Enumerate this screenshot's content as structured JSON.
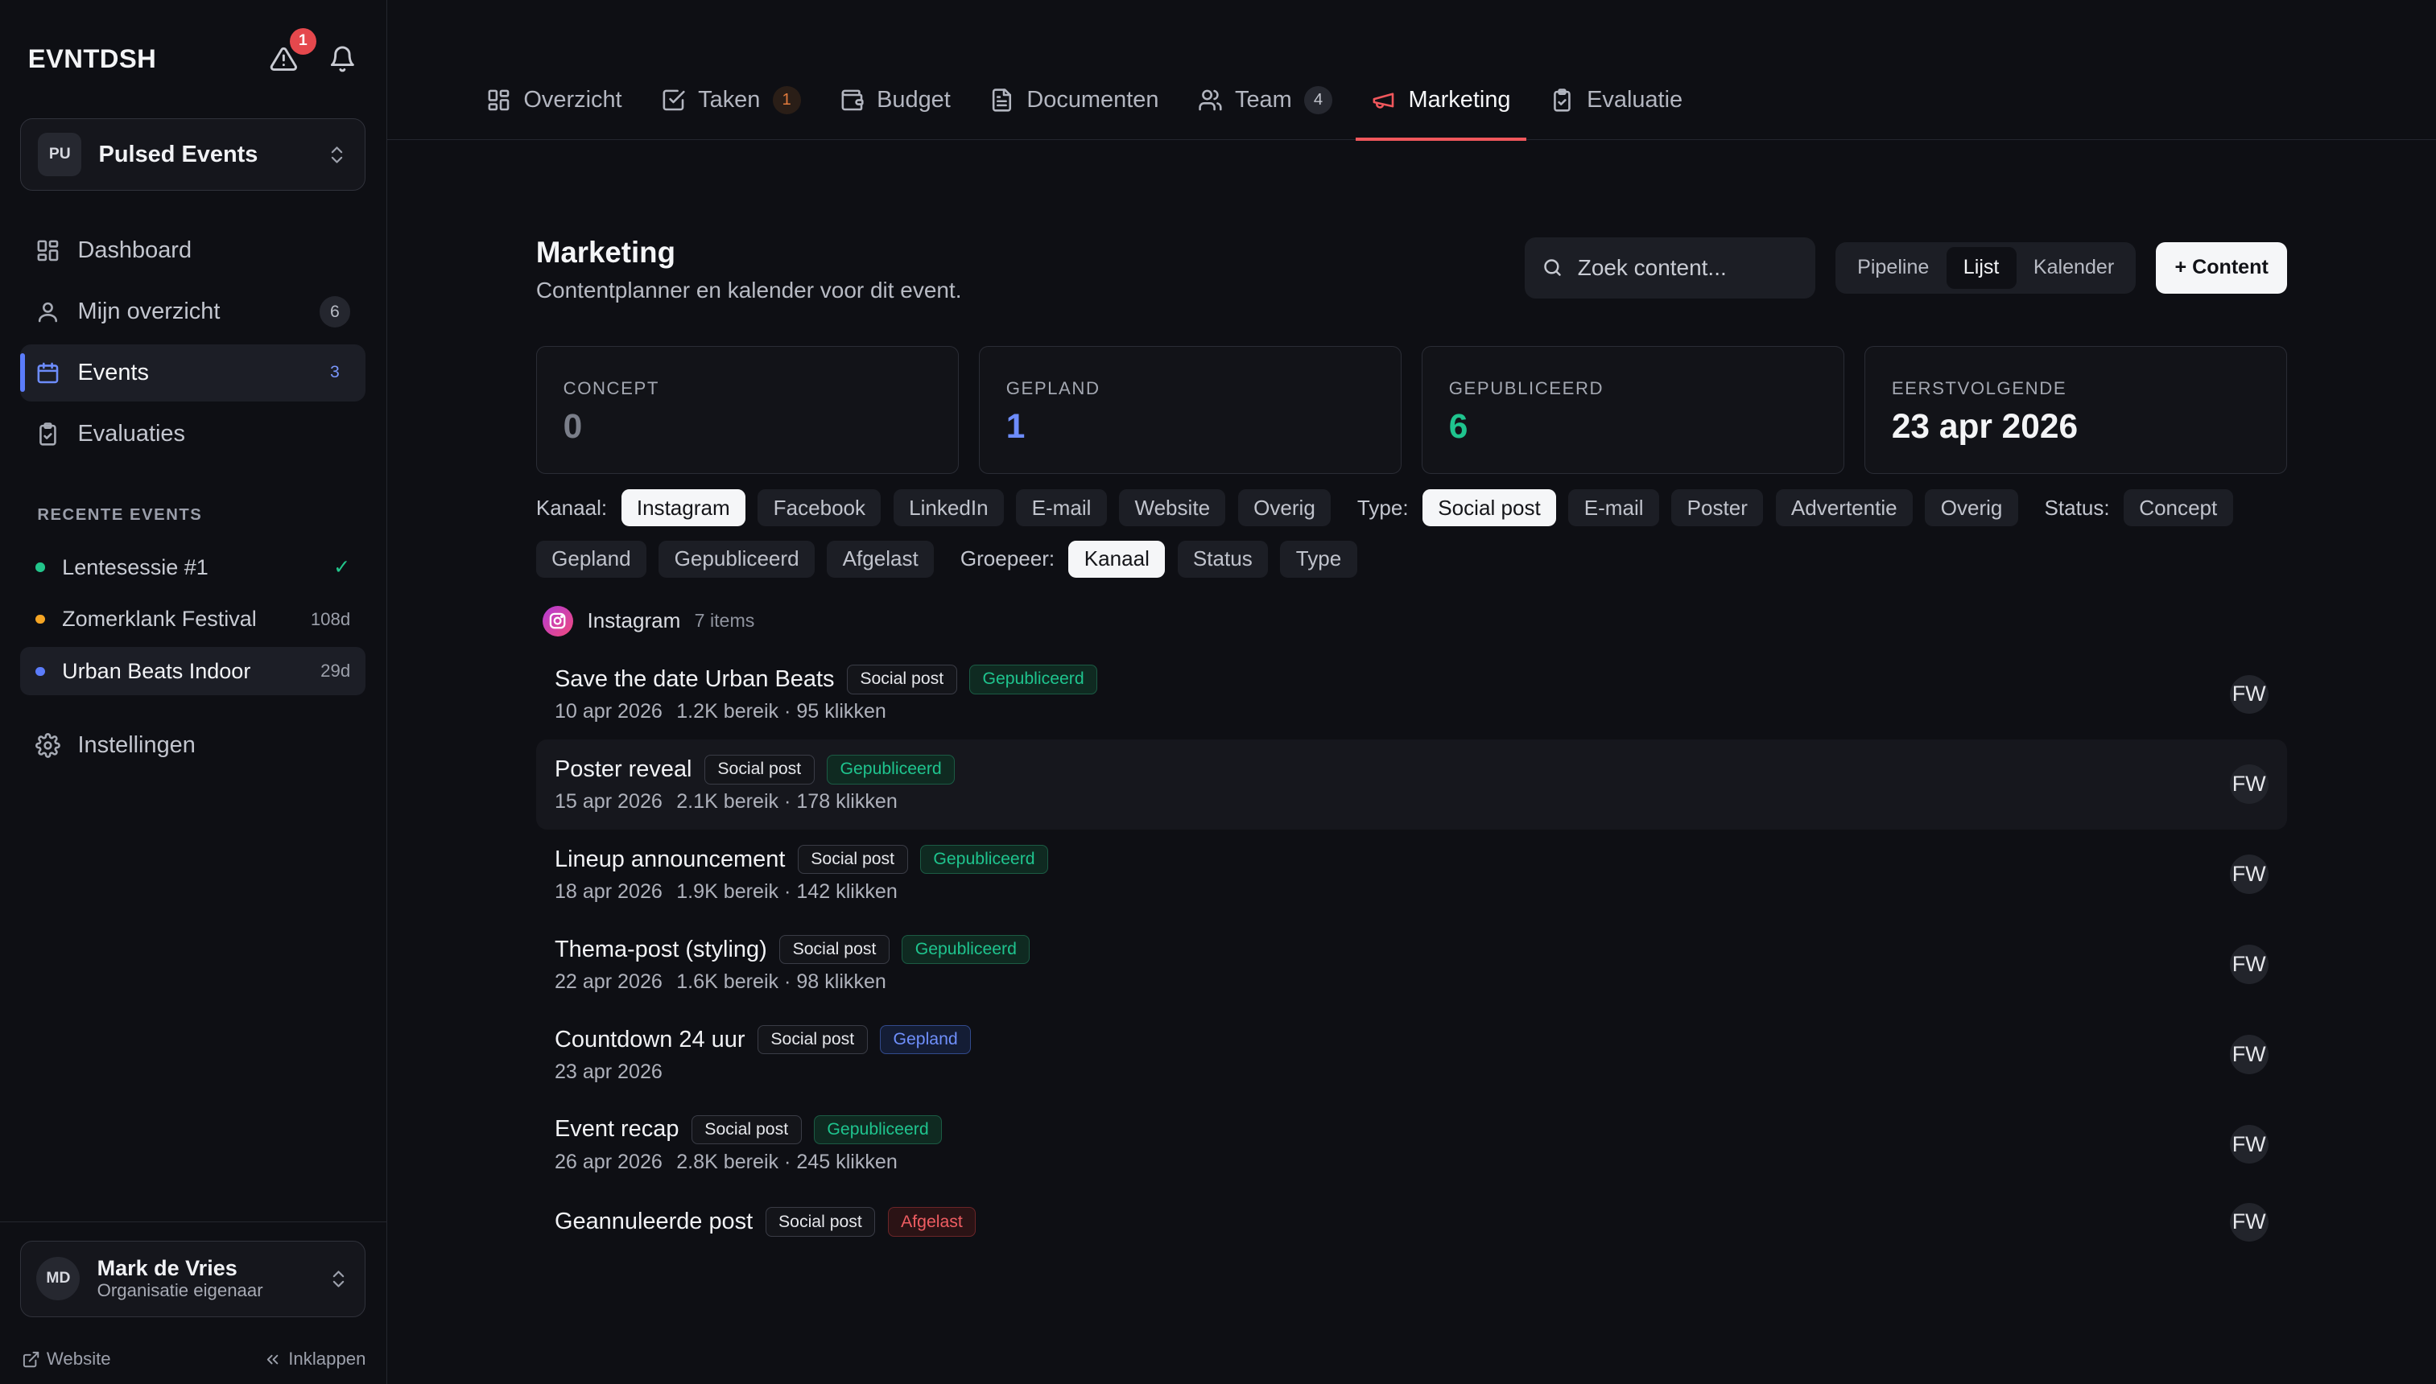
{
  "app": {
    "brand": "EVNTDSH",
    "alert_count": "1"
  },
  "org": {
    "initials": "PU",
    "name": "Pulsed Events"
  },
  "nav": [
    {
      "label": "Dashboard",
      "icon": "dashboard-icon",
      "count": ""
    },
    {
      "label": "Mijn overzicht",
      "icon": "user-icon",
      "count": "6"
    },
    {
      "label": "Events",
      "icon": "calendar-icon",
      "count": "3"
    },
    {
      "label": "Evaluaties",
      "icon": "clipboard-icon",
      "count": ""
    }
  ],
  "recent": {
    "label": "RECENTE EVENTS",
    "items": [
      {
        "name": "Lentesessie #1",
        "meta": "✓",
        "dot": "#22c58b"
      },
      {
        "name": "Zomerklank Festival",
        "meta": "108d",
        "dot": "#f5a524"
      },
      {
        "name": "Urban Beats Indoor",
        "meta": "29d",
        "dot": "#5b7cfa"
      }
    ]
  },
  "settings_label": "Instellingen",
  "user": {
    "initials": "MD",
    "name": "Mark de Vries",
    "role": "Organisatie eigenaar"
  },
  "footer": {
    "website": "Website",
    "collapse": "Inklappen"
  },
  "tabs": [
    {
      "label": "Overzicht",
      "icon": "grid-icon",
      "count": ""
    },
    {
      "label": "Taken",
      "icon": "checkbox-icon",
      "count": "1"
    },
    {
      "label": "Budget",
      "icon": "wallet-icon",
      "count": ""
    },
    {
      "label": "Documenten",
      "icon": "document-icon",
      "count": ""
    },
    {
      "label": "Team",
      "icon": "users-icon",
      "count": "4"
    },
    {
      "label": "Marketing",
      "icon": "megaphone-icon",
      "count": ""
    },
    {
      "label": "Evaluatie",
      "icon": "clipboard-icon",
      "count": ""
    }
  ],
  "page": {
    "title": "Marketing",
    "subtitle": "Contentplanner en kalender voor dit event.",
    "search_placeholder": "Zoek content...",
    "views": [
      "Pipeline",
      "Lijst",
      "Kalender"
    ],
    "active_view": "Lijst",
    "add_label": "+ Content"
  },
  "stats": [
    {
      "label": "CONCEPT",
      "value": "0"
    },
    {
      "label": "GEPLAND",
      "value": "1"
    },
    {
      "label": "GEPUBLICEERD",
      "value": "6"
    },
    {
      "label": "EERSTVOLGENDE",
      "value": "23 apr 2026"
    }
  ],
  "filters": {
    "kanaal_label": "Kanaal:",
    "kanaal": [
      "Instagram",
      "Facebook",
      "LinkedIn",
      "E-mail",
      "Website",
      "Overig"
    ],
    "type_label": "Type:",
    "type": [
      "Social post",
      "E-mail",
      "Poster",
      "Advertentie",
      "Overig"
    ],
    "status_label": "Status:",
    "status": [
      "Concept",
      "Gepland",
      "Gepubliceerd",
      "Afgelast"
    ],
    "group_label": "Groepeer:",
    "group": [
      "Kanaal",
      "Status",
      "Type"
    ]
  },
  "group": {
    "name": "Instagram",
    "count": "7 items"
  },
  "items": [
    {
      "title": "Save the date Urban Beats",
      "type": "Social post",
      "status": "Gepubliceerd",
      "date": "10 apr 2026",
      "stats": "1.2K bereik · 95 klikken",
      "owner": "FW"
    },
    {
      "title": "Poster reveal",
      "type": "Social post",
      "status": "Gepubliceerd",
      "date": "15 apr 2026",
      "stats": "2.1K bereik · 178 klikken",
      "owner": "FW"
    },
    {
      "title": "Lineup announcement",
      "type": "Social post",
      "status": "Gepubliceerd",
      "date": "18 apr 2026",
      "stats": "1.9K bereik · 142 klikken",
      "owner": "FW"
    },
    {
      "title": "Thema-post (styling)",
      "type": "Social post",
      "status": "Gepubliceerd",
      "date": "22 apr 2026",
      "stats": "1.6K bereik · 98 klikken",
      "owner": "FW"
    },
    {
      "title": "Countdown 24 uur",
      "type": "Social post",
      "status": "Gepland",
      "date": "23 apr 2026",
      "stats": "",
      "owner": "FW"
    },
    {
      "title": "Event recap",
      "type": "Social post",
      "status": "Gepubliceerd",
      "date": "26 apr 2026",
      "stats": "2.8K bereik · 245 klikken",
      "owner": "FW"
    },
    {
      "title": "Geannuleerde post",
      "type": "Social post",
      "status": "Afgelast",
      "date": "",
      "stats": "",
      "owner": "FW"
    }
  ],
  "colors": {
    "accent_blue": "#5b7cfa",
    "accent_red": "#f0575c",
    "published_green": "#1fc48e",
    "planned_blue": "#6f8ffb",
    "cancelled_red": "#ef5d62"
  }
}
